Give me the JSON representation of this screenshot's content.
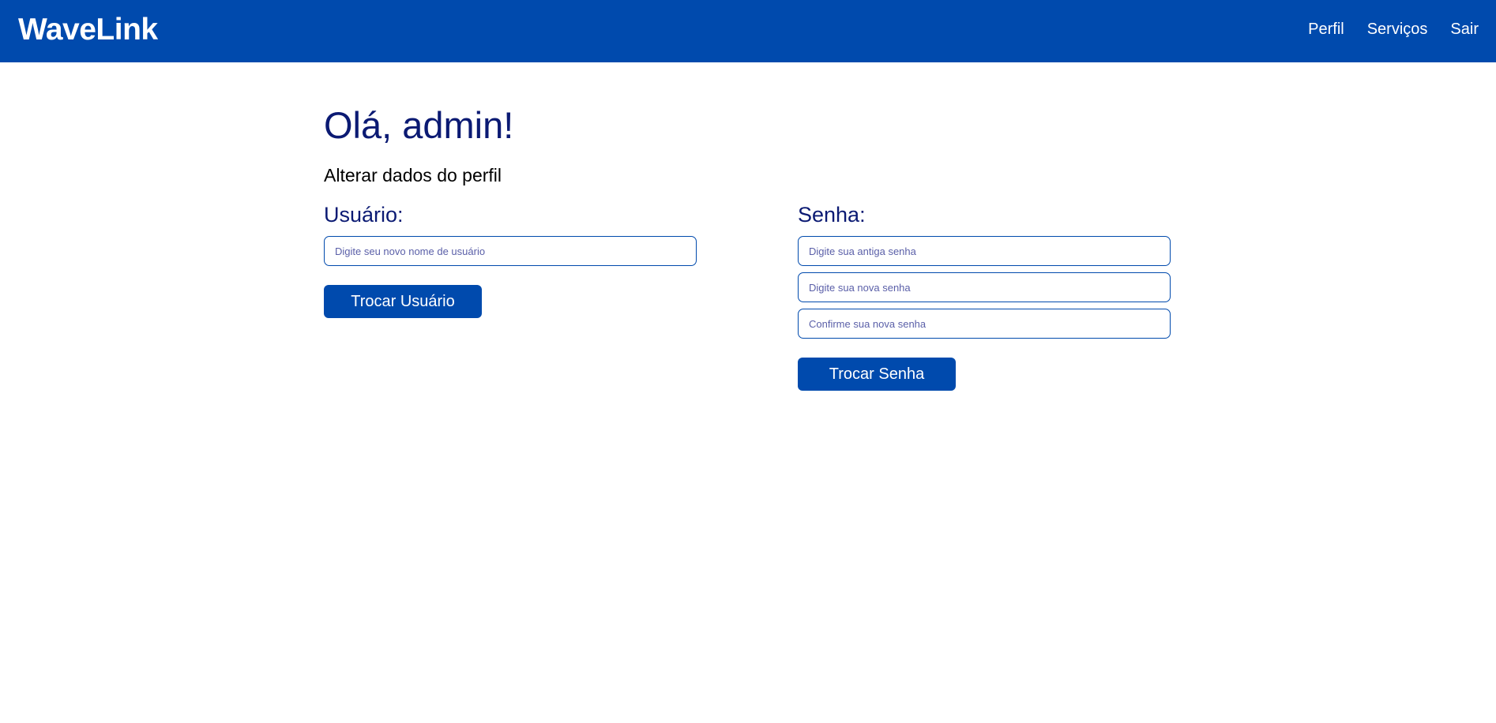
{
  "header": {
    "brand": "WaveLink",
    "nav": [
      {
        "label": "Perfil"
      },
      {
        "label": "Serviços"
      },
      {
        "label": "Sair"
      }
    ]
  },
  "main": {
    "greeting": "Olá, admin!",
    "subtitle": "Alterar dados do perfil",
    "user_section": {
      "title": "Usuário:",
      "username_placeholder": "Digite seu novo nome de usuário",
      "button_label": "Trocar Usuário"
    },
    "password_section": {
      "title": "Senha:",
      "old_password_placeholder": "Digite sua antiga senha",
      "new_password_placeholder": "Digite sua nova senha",
      "confirm_password_placeholder": "Confirme sua nova senha",
      "button_label": "Trocar Senha"
    }
  },
  "colors": {
    "navbar": "#004aad",
    "heading": "#0b1a73",
    "button": "#004aad"
  }
}
